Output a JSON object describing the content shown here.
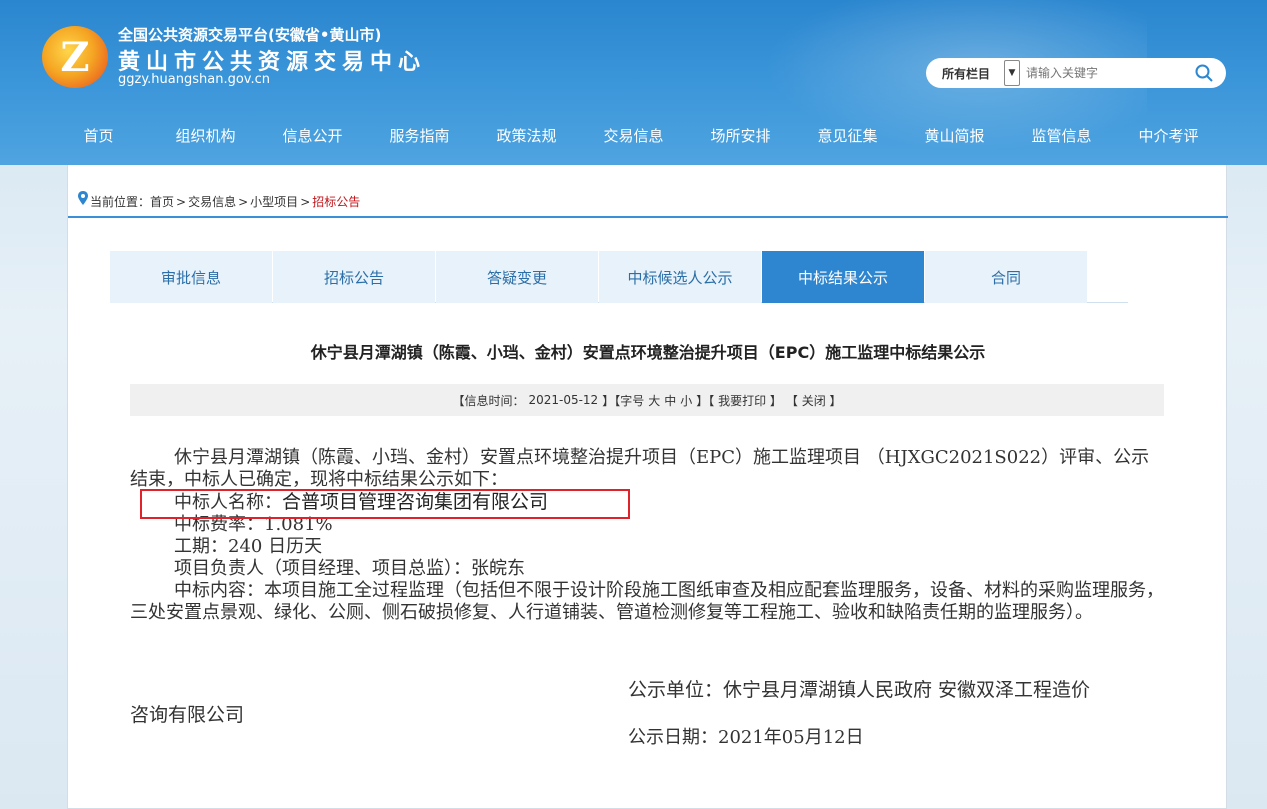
{
  "header": {
    "logo_letter": "Z",
    "platform_name": "全国公共资源交易平台(安徽省•黄山市)",
    "center_name": "黄山市公共资源交易中心",
    "domain": "ggzy.huangshan.gov.cn"
  },
  "search": {
    "scope": "所有栏目",
    "placeholder": "请输入关键字"
  },
  "nav": [
    "首页",
    "组织机构",
    "信息公开",
    "服务指南",
    "政策法规",
    "交易信息",
    "场所安排",
    "意见征集",
    "黄山简报",
    "监管信息",
    "中介考评"
  ],
  "breadcrumb": {
    "prefix": "当前位置：",
    "items": [
      "首页",
      "交易信息",
      "小型项目"
    ],
    "current": "招标公告"
  },
  "tabs": [
    {
      "label": "审批信息",
      "active": false
    },
    {
      "label": "招标公告",
      "active": false
    },
    {
      "label": "答疑变更",
      "active": false
    },
    {
      "label": "中标候选人公示",
      "active": false
    },
    {
      "label": "中标结果公示",
      "active": true
    },
    {
      "label": "合同",
      "active": false
    }
  ],
  "article": {
    "title": "休宁县月潭湖镇（陈霞、小珰、金村）安置点环境整治提升项目（EPC）施工监理中标结果公示",
    "info_time_label": "【信息时间：",
    "info_time": "2021-05-12",
    "font_size_label": "】【字号",
    "font_large": "大",
    "font_medium": "中",
    "font_small": "小",
    "print": "】【 我要打印 】",
    "close": "【 关闭 】",
    "intro": "休宁县月潭湖镇（陈霞、小珰、金村）安置点环境整治提升项目（EPC）施工监理项目 （HJXGC2021S022）评审、公示结束，中标人已确定，现将中标结果公示如下：",
    "winner_label": "中标人名称：",
    "winner": "合普项目管理咨询集团有限公司",
    "rate": "中标费率：1.081%",
    "period": "工期：240 日历天",
    "manager": "项目负责人（项目经理、项目总监）：张皖东",
    "content": "中标内容：本项目施工全过程监理（包括但不限于设计阶段施工图纸审查及相应配套监理服务，设备、材料的采购监理服务，三处安置点景观、绿化、公厕、侧石破损修复、人行道铺装、管道检测修复等工程施工、验收和缺陷责任期的监理服务）。",
    "publisher": "公示单位：休宁县月潭湖镇人民政府 安徽双泽工程造价",
    "publisher_cont": "咨询有限公司",
    "date": "公示日期：2021年05月12日"
  }
}
